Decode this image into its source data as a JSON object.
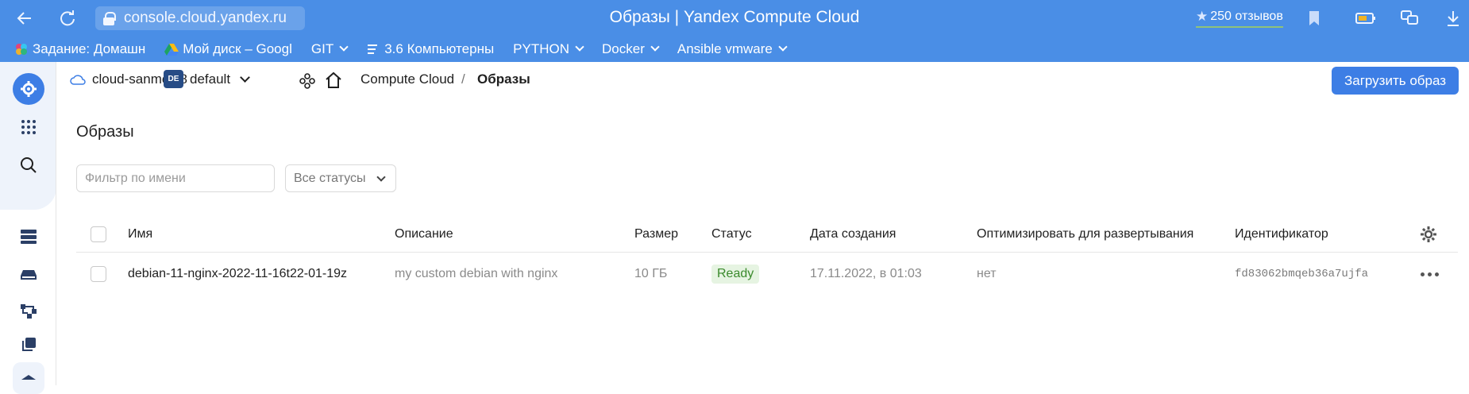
{
  "browser": {
    "tab_title": "Образы | Yandex Compute Cloud",
    "url": "console.cloud.yandex.ru",
    "reviews_label": "250 отзывов"
  },
  "bookmarks": [
    {
      "label": "Задание: Домашн",
      "has_menu": false,
      "icon": "slack-like-icon"
    },
    {
      "label": "Мой диск – Googl",
      "has_menu": false,
      "icon": "google-drive-icon"
    },
    {
      "label": "GIT",
      "has_menu": true
    },
    {
      "label": "3.6 Компьютерны",
      "has_menu": false,
      "icon": "document-icon"
    },
    {
      "label": "PYTHON",
      "has_menu": true
    },
    {
      "label": "Docker",
      "has_menu": true
    },
    {
      "label": "Ansible vmware",
      "has_menu": true
    }
  ],
  "console": {
    "cloud": "cloud-sanmol88",
    "folder_badge": "DE",
    "folder": "default",
    "breadcrumb": {
      "service": "Compute Cloud",
      "separator": "/",
      "current": "Образы"
    },
    "upload_button": "Загрузить образ"
  },
  "page": {
    "title": "Образы",
    "filter_placeholder": "Фильтр по имени",
    "status_filter": "Все статусы"
  },
  "table": {
    "columns": {
      "name": "Имя",
      "description": "Описание",
      "size": "Размер",
      "status": "Статус",
      "created": "Дата создания",
      "optimize": "Оптимизировать для развертывания",
      "id": "Идентификатор"
    },
    "rows": [
      {
        "name": "debian-11-nginx-2022-11-16t22-01-19z",
        "description": "my custom debian with nginx",
        "size": "10 ГБ",
        "status": "Ready",
        "created": "17.11.2022, в 01:03",
        "optimize": "нет",
        "id": "fd83062bmqeb36a7ujfa"
      }
    ]
  },
  "colors": {
    "chrome": "#4a8ee6",
    "accent": "#3d7ee5",
    "ready_bg": "#e6f4e2",
    "ready_fg": "#3a8a2c"
  }
}
